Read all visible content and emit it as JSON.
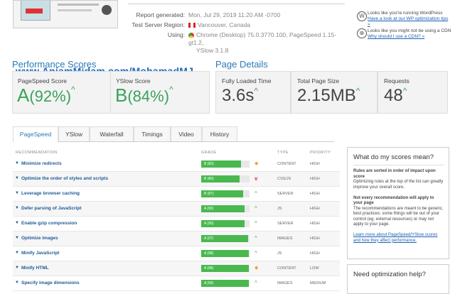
{
  "report": {
    "generated_label": "Report generated:",
    "generated_value": "Mon, Jul 29, 2019 11:20 AM -0700",
    "region_label": "Test Server Region:",
    "region_value": "Vancouver, Canada",
    "using_label": "Using:",
    "using_value_1": "Chrome (Desktop) 75.0.3770.100, PageSpeed 1.15-gt1.2,",
    "using_value_2": "YSlow 3.1.8"
  },
  "side_notes": {
    "wp_1": "Looks like you're running WordPress",
    "wp_2": "Have a look at our WP optimization tips »",
    "cdn_1": "Looks like you might not be using a CDN",
    "cdn_2": "Why should I use a CDN? »"
  },
  "performance": {
    "title": "Performance Scores",
    "watermark": "www.AnjamMidam.com/MohamadMJ",
    "pagespeed_label": "PageSpeed Score",
    "pagespeed_grade": "A",
    "pagespeed_pct": "(92%)",
    "yslow_label": "YSlow Score",
    "yslow_grade": "B",
    "yslow_pct": "(84%)"
  },
  "details": {
    "title": "Page Details",
    "load_label": "Fully Loaded Time",
    "load_value": "3.6s",
    "size_label": "Total Page Size",
    "size_value": "2.15MB",
    "req_label": "Requests",
    "req_value": "48"
  },
  "tabs": [
    "PageSpeed",
    "YSlow",
    "Waterfall",
    "Timings",
    "Video",
    "History"
  ],
  "table": {
    "headers": {
      "rec": "RECOMMENDATION",
      "grade": "GRADE",
      "type": "TYPE",
      "prio": "PRIORITY"
    },
    "rows": [
      {
        "name": "Minimize redirects",
        "grade": "B (83)",
        "score": 83,
        "trend": "diamond",
        "type": "CONTENT",
        "prio": "HIGH"
      },
      {
        "name": "Optimize the order of styles and scripts",
        "grade": "B (80)",
        "score": 80,
        "trend": "down",
        "type": "CSS/JS",
        "prio": "HIGH"
      },
      {
        "name": "Leverage browser caching",
        "grade": "B (87)",
        "score": 87,
        "trend": "up",
        "type": "SERVER",
        "prio": "HIGH"
      },
      {
        "name": "Defer parsing of JavaScript",
        "grade": "A (90)",
        "score": 90,
        "trend": "up",
        "type": "JS",
        "prio": "HIGH"
      },
      {
        "name": "Enable gzip compression",
        "grade": "A (90)",
        "score": 90,
        "trend": "up",
        "type": "SERVER",
        "prio": "HIGH"
      },
      {
        "name": "Optimize images",
        "grade": "A (97)",
        "score": 97,
        "trend": "up",
        "type": "IMAGES",
        "prio": "HIGH"
      },
      {
        "name": "Minify JavaScript",
        "grade": "A (98)",
        "score": 98,
        "trend": "up",
        "type": "JS",
        "prio": "HIGH"
      },
      {
        "name": "Minify HTML",
        "grade": "A (98)",
        "score": 98,
        "trend": "diamond",
        "type": "CONTENT",
        "prio": "LOW"
      },
      {
        "name": "Specify image dimensions",
        "grade": "A (99)",
        "score": 99,
        "trend": "up",
        "type": "IMAGES",
        "prio": "MEDIUM"
      }
    ]
  },
  "right_panel": {
    "title": "What do my scores mean?",
    "p1_bold": "Rules are sorted in order of impact upon score",
    "p1": "Optimizing rules at the top of the list can greatly improve your overall score.",
    "p2_bold": "Not every recommendation will apply to your page",
    "p2": "The recommendations are meant to be generic, best practices; some things will be out of your control (eg. external resources) or may not apply to your page.",
    "link": "Learn more about PageSpeed/YSlow scores and how they affect performance.",
    "help_title": "Need optimization help?"
  },
  "colors": {
    "accent": "#2a7ab8",
    "good": "#49b84f",
    "warn": "#f0a030",
    "bad": "#d33"
  }
}
